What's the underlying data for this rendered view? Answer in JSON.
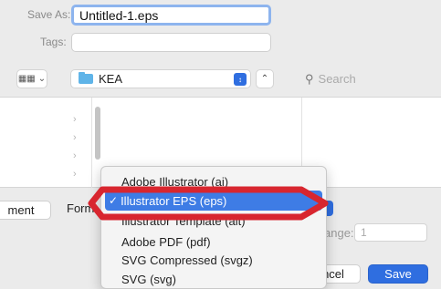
{
  "dialog": {
    "save_as_label": "Save As:",
    "save_as_value": "Untitled-1.eps",
    "tags_label": "Tags:",
    "tags_value": "",
    "view_icon": "grid-icon",
    "location": "KEA",
    "search_placeholder": "Search"
  },
  "footer": {
    "left_button": "ment",
    "format_label": "Form",
    "range_label": "ange:",
    "range_value": "1",
    "cancel_button": "ncel",
    "save_button": "Save"
  },
  "format_menu": {
    "items": [
      "Adobe Illustrator (ai)",
      "Illustrator EPS (eps)",
      "Illustrator Template (ait)",
      "Adobe PDF (pdf)",
      "SVG Compressed (svgz)",
      "SVG (svg)"
    ],
    "selected_index": 1
  },
  "colors": {
    "accent": "#3e7ce5",
    "annotation_arrow": "#d8262f"
  }
}
